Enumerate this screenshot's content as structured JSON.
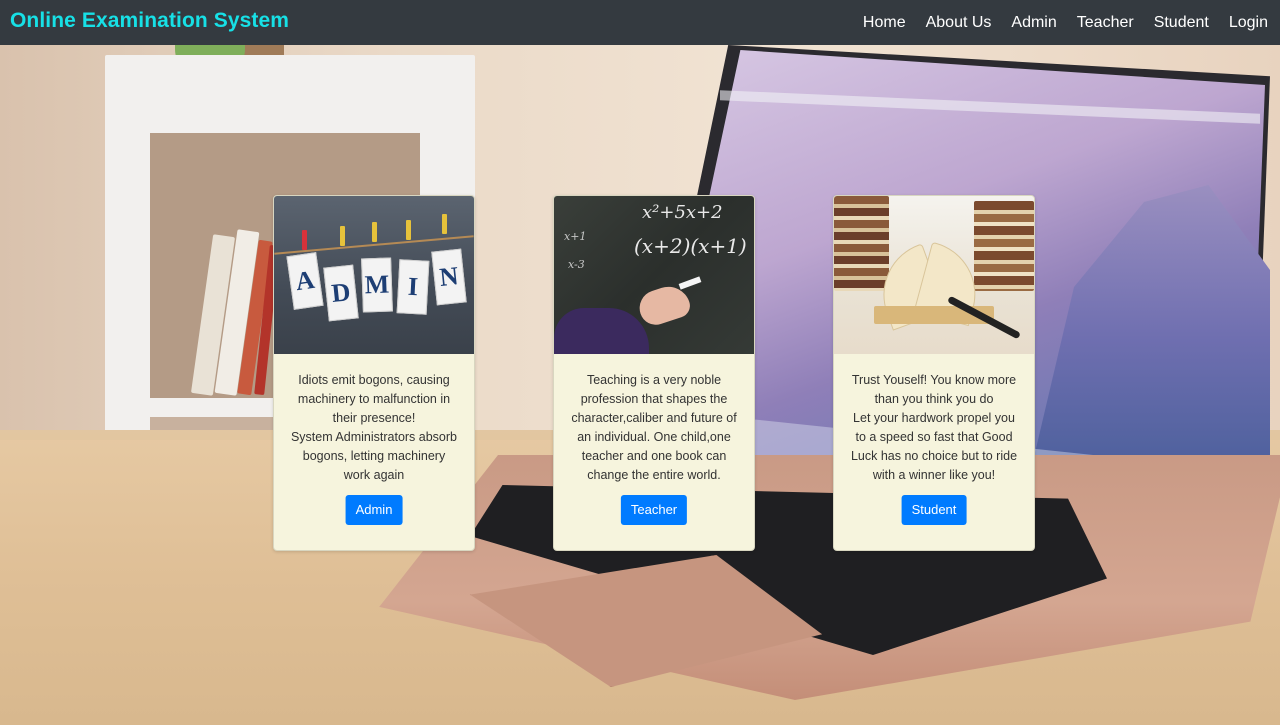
{
  "navbar": {
    "brand": "Online Examination System",
    "links": [
      "Home",
      "About Us",
      "Admin",
      "Teacher",
      "Student",
      "Login"
    ]
  },
  "cards": [
    {
      "image_letters": [
        "A",
        "D",
        "M",
        "I",
        "N"
      ],
      "text": "Idiots emit bogons, causing machinery to malfunction in their presence!\nSystem Administrators absorb bogons, letting machinery work again",
      "button": "Admin"
    },
    {
      "image_formulas": [
        "x²+5x+2",
        "(x+2)(x+1)",
        "x+1",
        "x-3"
      ],
      "text": "Teaching is a very noble profession that shapes the character,caliber and future of an individual. One child,one teacher and one book can change the entire world.",
      "button": "Teacher"
    },
    {
      "text": "Trust Youself! You know more than you think you do\nLet your hardwork propel you to a speed so fast that Good Luck has no choice but to ride with a winner like you!",
      "button": "Student"
    }
  ],
  "colors": {
    "navbar_bg": "#343a40",
    "brand": "#17e0e6",
    "card_bg": "#f6f4dd",
    "button_bg": "#007bff"
  }
}
